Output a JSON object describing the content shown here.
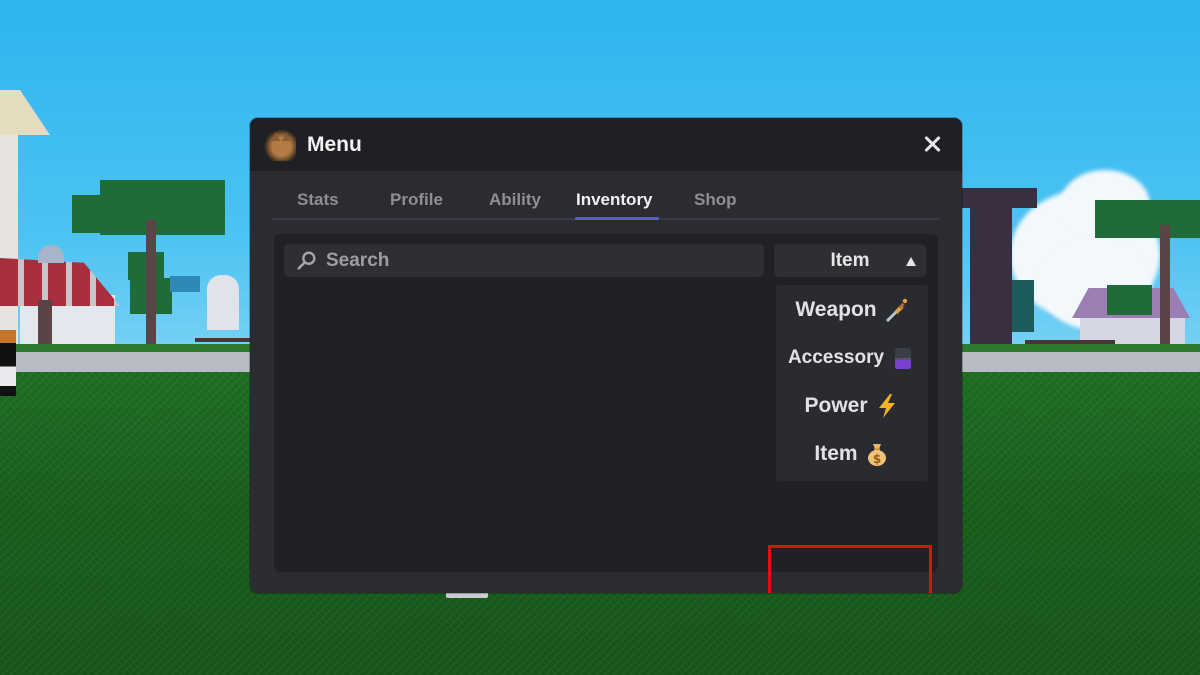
{
  "window": {
    "title": "Menu",
    "logo_icon": "caracal-cat-avatar",
    "close_icon": "close-x"
  },
  "tabs": [
    {
      "label": "Stats",
      "active": false
    },
    {
      "label": "Profile",
      "active": false
    },
    {
      "label": "Ability",
      "active": false
    },
    {
      "label": "Inventory",
      "active": true
    },
    {
      "label": "Shop",
      "active": false
    }
  ],
  "inventory": {
    "search": {
      "placeholder": "Search",
      "value": "",
      "icon": "search-icon"
    },
    "filter_dropdown": {
      "selected": "Item",
      "arrow_icon": "triangle-up",
      "expanded": true,
      "options": [
        {
          "label": "Weapon",
          "icon": "dagger-emoji"
        },
        {
          "label": "Accessory",
          "icon": "purple-can-emoji"
        },
        {
          "label": "Power",
          "icon": "lightning-emoji"
        },
        {
          "label": "Item",
          "icon": "money-bag-emoji",
          "highlighted": true
        }
      ]
    },
    "items": []
  },
  "colors": {
    "accent": "#5b5bd6",
    "highlight_box": "#e01010",
    "panel": "#2b2c31",
    "header": "#1f2024",
    "content": "#202125"
  }
}
